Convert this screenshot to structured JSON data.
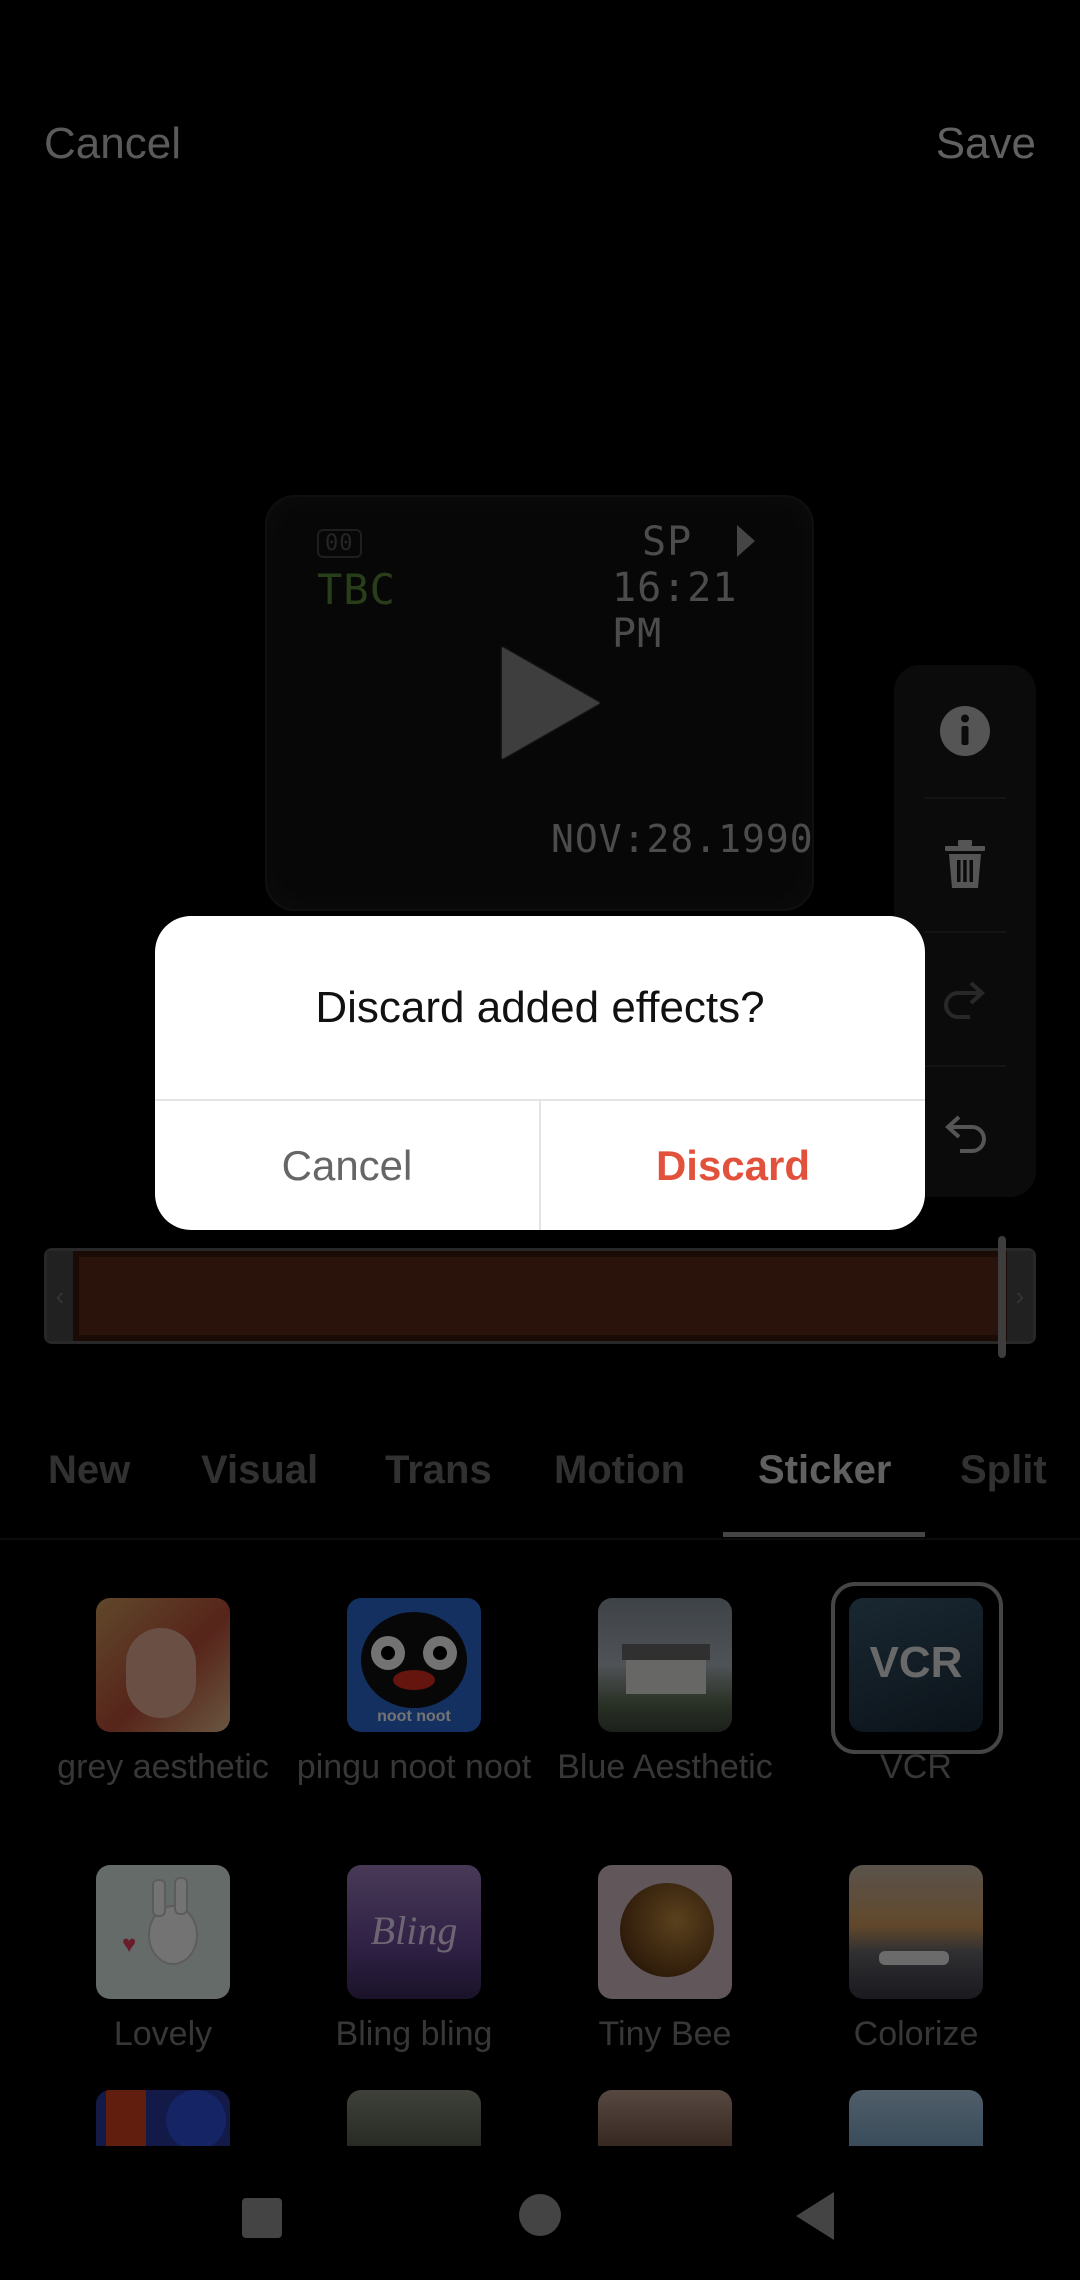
{
  "header": {
    "cancel_label": "Cancel",
    "save_label": "Save"
  },
  "preview": {
    "osd_small": "00",
    "osd_tbc": "TBC",
    "osd_sp": "SP",
    "osd_time": "16:21 PM",
    "osd_date": "NOV:28.1990"
  },
  "side_toolbar": {
    "icons": [
      "info-icon",
      "trash-icon",
      "redo-icon",
      "undo-icon"
    ]
  },
  "tabs": [
    {
      "label": "New"
    },
    {
      "label": "Visual"
    },
    {
      "label": "Trans"
    },
    {
      "label": "Motion"
    },
    {
      "label": "Sticker",
      "active": true
    },
    {
      "label": "Split"
    }
  ],
  "effects": [
    {
      "label": "grey aesthetic"
    },
    {
      "label": "pingu noot noot",
      "thumb_text": "noot noot"
    },
    {
      "label": "Blue Aesthetic"
    },
    {
      "label": "VCR",
      "thumb_text": "VCR",
      "selected": true
    },
    {
      "label": "Lovely"
    },
    {
      "label": "Bling bling",
      "thumb_text": "Bling"
    },
    {
      "label": "Tiny Bee"
    },
    {
      "label": "Colorize"
    }
  ],
  "dialog": {
    "title": "Discard added effects?",
    "cancel_label": "Cancel",
    "discard_label": "Discard"
  },
  "colors": {
    "accent": "#e2513c",
    "timeline_fill": "#5e2c1a"
  }
}
